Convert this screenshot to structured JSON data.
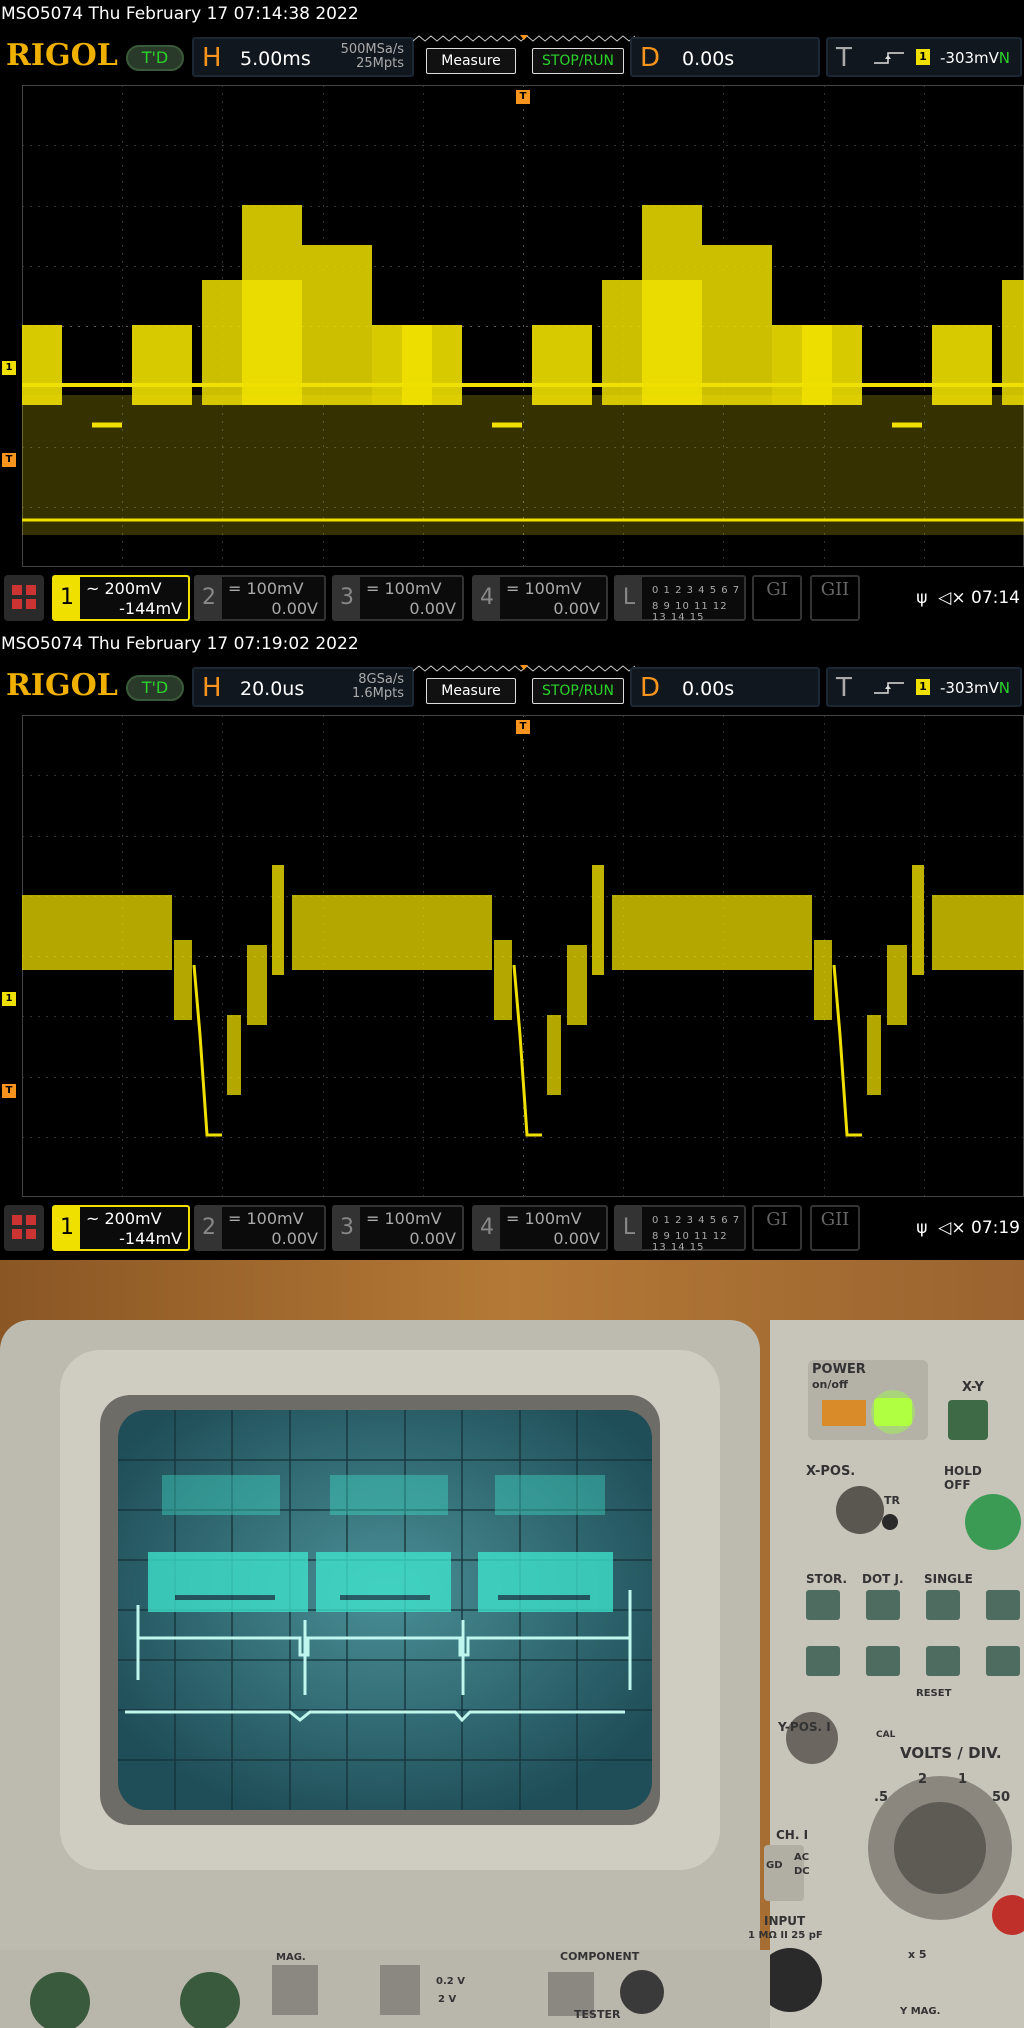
{
  "screen1": {
    "title": "MSO5074  Thu February 17 07:14:38 2022",
    "logo": "RIGOL",
    "mode": "T'D",
    "horizontal": {
      "key": "H",
      "timebase": "5.00ms",
      "sample_rate": "500MSa/s",
      "memory": "25Mpts"
    },
    "measure_label": "Measure",
    "stoprun_label": "STOP/RUN",
    "delay": {
      "key": "D",
      "value": "0.00s"
    },
    "trigger": {
      "key": "T",
      "channel": "1",
      "level": "-303mV",
      "mode": "N"
    },
    "channels": [
      {
        "num": "1",
        "scale": "200mV",
        "offset": "-144mV",
        "coupling": "~"
      },
      {
        "num": "2",
        "scale": "100mV",
        "offset": "0.00V",
        "coupling": "="
      },
      {
        "num": "3",
        "scale": "100mV",
        "offset": "0.00V",
        "coupling": "="
      },
      {
        "num": "4",
        "scale": "100mV",
        "offset": "0.00V",
        "coupling": "="
      }
    ],
    "logic": {
      "key": "L",
      "row1": "0 1 2 3  4 5 6 7",
      "row2": "8 9 10 11 12 13 14 15"
    },
    "gen1": "GI",
    "gen2": "GII",
    "time": "07:14",
    "mute_icon": "speaker-mute-icon",
    "usb_icon": "usb-icon"
  },
  "screen2": {
    "title": "MSO5074  Thu February 17 07:19:02 2022",
    "logo": "RIGOL",
    "mode": "T'D",
    "horizontal": {
      "key": "H",
      "timebase": "20.0us",
      "sample_rate": "8GSa/s",
      "memory": "1.6Mpts"
    },
    "measure_label": "Measure",
    "stoprun_label": "STOP/RUN",
    "delay": {
      "key": "D",
      "value": "0.00s"
    },
    "trigger": {
      "key": "T",
      "channel": "1",
      "level": "-303mV",
      "mode": "N"
    },
    "channels": [
      {
        "num": "1",
        "scale": "200mV",
        "offset": "-144mV",
        "coupling": "~"
      },
      {
        "num": "2",
        "scale": "100mV",
        "offset": "0.00V",
        "coupling": "="
      },
      {
        "num": "3",
        "scale": "100mV",
        "offset": "0.00V",
        "coupling": "="
      },
      {
        "num": "4",
        "scale": "100mV",
        "offset": "0.00V",
        "coupling": "="
      }
    ],
    "logic": {
      "key": "L",
      "row1": "0 1 2 3  4 5 6 7",
      "row2": "8 9 10 11 12 13 14 15"
    },
    "gen1": "GI",
    "gen2": "GII",
    "time": "07:19"
  },
  "photo": {
    "labels": {
      "power": "POWER",
      "onoff": "on/off",
      "xy": "X-Y",
      "xpos": "X-POS.",
      "hold": "HOLD OFF",
      "tr": "TR",
      "stor": "STOR.",
      "dotj": "DOT J.",
      "single": "SINGLE",
      "reset": "RESET",
      "ypos": "Y-POS. I",
      "cal": "CAL",
      "voltsdiv": "VOLTS / DIV.",
      "ch1": "CH. I",
      "gd": "GD",
      "ac": "AC",
      "dc": "DC",
      "input": "INPUT",
      "input_spec": "1 MΩ II 25 pF",
      "mag": "MAG.",
      "component": "COMPONENT",
      "tester": "TESTER",
      "cal_v1": "0.2 V",
      "cal_v2": "2 V",
      "x5": "x 5",
      "ymag": "Y MAG.",
      "v50": "50",
      "v5": ".5",
      "v2": "2",
      "v1": "1"
    },
    "colors": {
      "trace": "#3fe8d0",
      "crt": "#2f6f7a",
      "wood": "#a66a2c",
      "bezel": "#c8c6bc"
    }
  },
  "colors": {
    "ch1": "#f0e000",
    "trigger_orange": "#f7941d",
    "run_green": "#2bd12b"
  }
}
